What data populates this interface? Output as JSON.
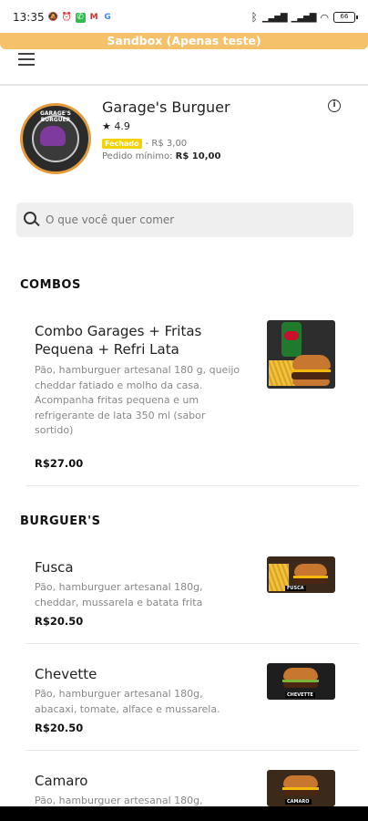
{
  "status": {
    "time": "13:35",
    "battery": "66"
  },
  "sandbox_label": "Sandbox (Apenas teste)",
  "store": {
    "logo_text": "GARAGE'S BURGUER",
    "name": "Garage's Burguer",
    "rating_star": "★",
    "rating": "4.9",
    "status_badge": "Fechado",
    "delivery_fee": "- R$ 3,00",
    "minimum_label": "Pedido mínimo:",
    "minimum_value": "R$ 10,00"
  },
  "search": {
    "placeholder": "O que você quer comer"
  },
  "sections": {
    "combos": "COMBOS",
    "burgers": "BURGUER'S"
  },
  "items": [
    {
      "name": "Combo Garages + Fritas Pequena + Refri Lata",
      "description": "Pão, hamburguer artesanal 180 g, queijo cheddar fatiado e molho da casa.\nAcompanha fritas pequena e um refrigerante de lata 350 ml (sabor sortido)",
      "price": "R$27.00"
    },
    {
      "name": "Fusca",
      "description": "Pão, hamburguer artesanal 180g, cheddar, mussarela e batata frita",
      "price": "R$20.50",
      "thumb_label": "FUSCA"
    },
    {
      "name": "Chevette",
      "description": "Pão, hamburguer artesanal 180g, abacaxi, tomate, alface e mussarela.",
      "price": "R$20.50",
      "thumb_label": "CHEVETTE"
    },
    {
      "name": "Camaro",
      "description": "Pão, hamburguer artesanal 180g,",
      "price": "",
      "thumb_label": "CAMARO"
    }
  ]
}
